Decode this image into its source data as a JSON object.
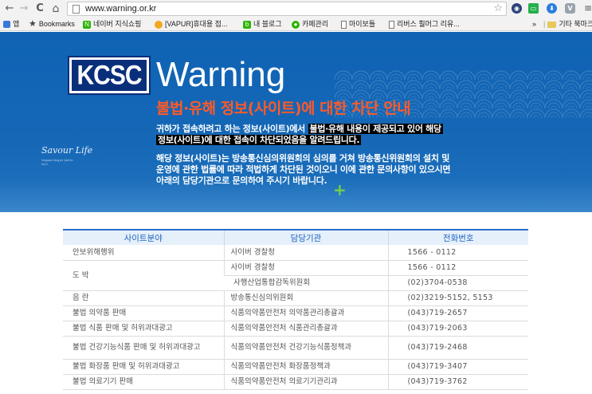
{
  "browser": {
    "url": "www.warning.or.kr",
    "nav": {
      "back": "←",
      "forward": "→",
      "reload": "C",
      "home": "⌂"
    },
    "bookmarks": [
      {
        "label": "앱",
        "icon": "apps-icon"
      },
      {
        "label": "Bookmarks",
        "icon": "star-icon"
      },
      {
        "label": "네이버 지식쇼핑",
        "icon": "naver-icon"
      },
      {
        "label": "[VAPUR]휴대용 접...",
        "icon": "vapur-icon"
      },
      {
        "label": "내 블로그",
        "icon": "blog-icon"
      },
      {
        "label": "카페관리",
        "icon": "cafe-icon"
      },
      {
        "label": "마이보틀",
        "icon": "page-icon"
      },
      {
        "label": "리버스 훨머그 리유...",
        "icon": "page-icon"
      }
    ],
    "more_label": "»",
    "other_bookmarks": "기타 북마크"
  },
  "hero": {
    "logo": "KCSC",
    "title": "Warning",
    "headline": "불법·유해 정보(사이트)에 대한 차단 안내",
    "notice_line1_plain": "귀하가 접속하려고 하는 정보(사이트)에서 ",
    "notice_line1_highlight": "불법·유해 내용이 제공되고 있어 해당",
    "notice_line2_highlight": "정보(사이트)에 대한 접속이 차단되었음을 알려드립니다.",
    "detail_line1": "해당 정보(사이트)는 방송통신심의위원회의 심의를 거쳐 방송통신위원회의 설치 및",
    "detail_line2": "운영에 관한 법률에 따라 적법하게 차단된 것이오니 이에 관한 문의사항이 있으시면",
    "detail_line3": "아래의 담당기관으로 문의하여 주시기 바랍니다.",
    "side_brand": "Savour Life",
    "side_sub": "Vaquas blog pe·just to try it",
    "colors": {
      "background": "#1567b6",
      "headline": "#ff5a28",
      "logo_bg": "#0a2f7a"
    }
  },
  "table": {
    "headers": [
      "사이트분야",
      "담당기관",
      "전화번호"
    ],
    "rows": [
      {
        "field": "안보위해행위",
        "agency": "사이버 경찰청",
        "phone": "1566 - 0112"
      },
      {
        "field": "도 박",
        "agency": "사이버 경찰청",
        "phone": "1566 - 0112"
      },
      {
        "field": "",
        "agency": "사행산업통합감독위원회",
        "phone": "(02)3704-0538"
      },
      {
        "field": "음 란",
        "agency": "방송통신심의위원회",
        "phone": "(02)3219-5152, 5153"
      },
      {
        "field": "불법 의약품 판매",
        "agency": "식품의약품안전처 의약품관리총괄과",
        "phone": "(043)719-2657"
      },
      {
        "field": "불법 식품 판매 및 허위과대광고",
        "agency": "식품의약품안전처 식품관리총괄과",
        "phone": "(043)719-2063"
      },
      {
        "field": "불법 건강기능식품 판매 및 허위과대광고",
        "agency": "식품의약품안전처 건강기능식품정책과",
        "phone": "(043)719-2468"
      },
      {
        "field": "불법 화장품 판매 및 허위과대광고",
        "agency": "식품의약품안전처 화장품정책과",
        "phone": "(043)719-3407"
      },
      {
        "field": "불법 의료기기 판매",
        "agency": "식품의약품안전처 의료기기관리과",
        "phone": "(043)719-3762"
      }
    ]
  }
}
